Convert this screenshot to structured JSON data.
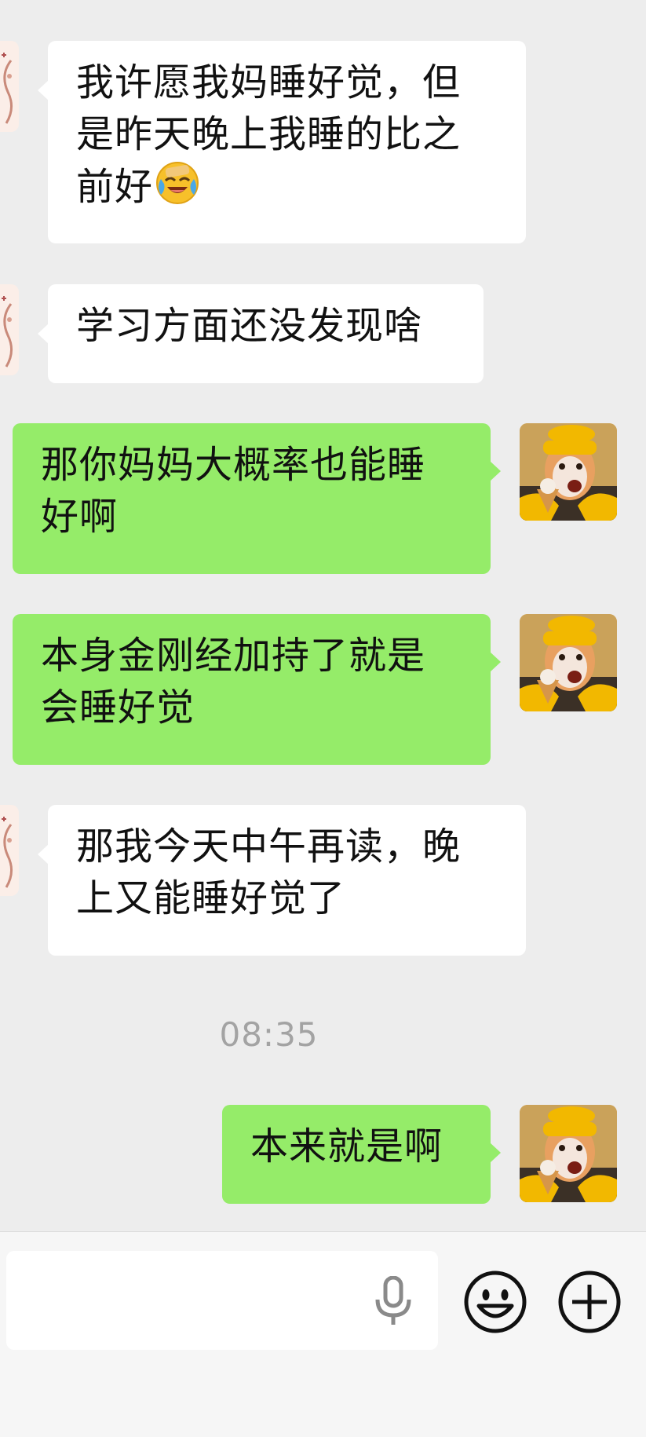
{
  "messages": [
    {
      "side": "in",
      "text": "我许愿我妈睡好觉，但是昨天晚上我睡的比之前好",
      "emoji": "rolling-on-floor-laughing"
    },
    {
      "side": "in",
      "text": "学习方面还没发现啥"
    },
    {
      "side": "out",
      "text": "那你妈妈大概率也能睡好啊"
    },
    {
      "side": "out",
      "text": "本身金刚经加持了就是会睡好觉"
    },
    {
      "side": "in",
      "text": "那我今天中午再读，晚上又能睡好觉了"
    },
    {
      "side": "out",
      "text": "本来就是啊"
    }
  ],
  "lines": {
    "m0": [
      "我许愿我妈睡好觉，但",
      "是昨天晚上我睡的比之",
      "前好"
    ],
    "m1": [
      "学习方面还没发现啥"
    ],
    "m2": [
      "那你妈妈大概率也能睡",
      "好啊"
    ],
    "m3": [
      "本身金刚经加持了就是",
      "会睡好觉"
    ],
    "m4": [
      "那我今天中午再读，晚",
      "上又能睡好觉了"
    ],
    "m5": [
      "本来就是啊"
    ]
  },
  "timestamp": "08:35",
  "input": {
    "value": "",
    "voice_icon": "microphone-icon",
    "emoji_icon": "smiley-face-icon",
    "more_icon": "plus-circle-icon"
  },
  "colors": {
    "background": "#ededed",
    "bubble_in": "#ffffff",
    "bubble_out": "#95ec69",
    "timestamp": "#a3a3a3"
  }
}
